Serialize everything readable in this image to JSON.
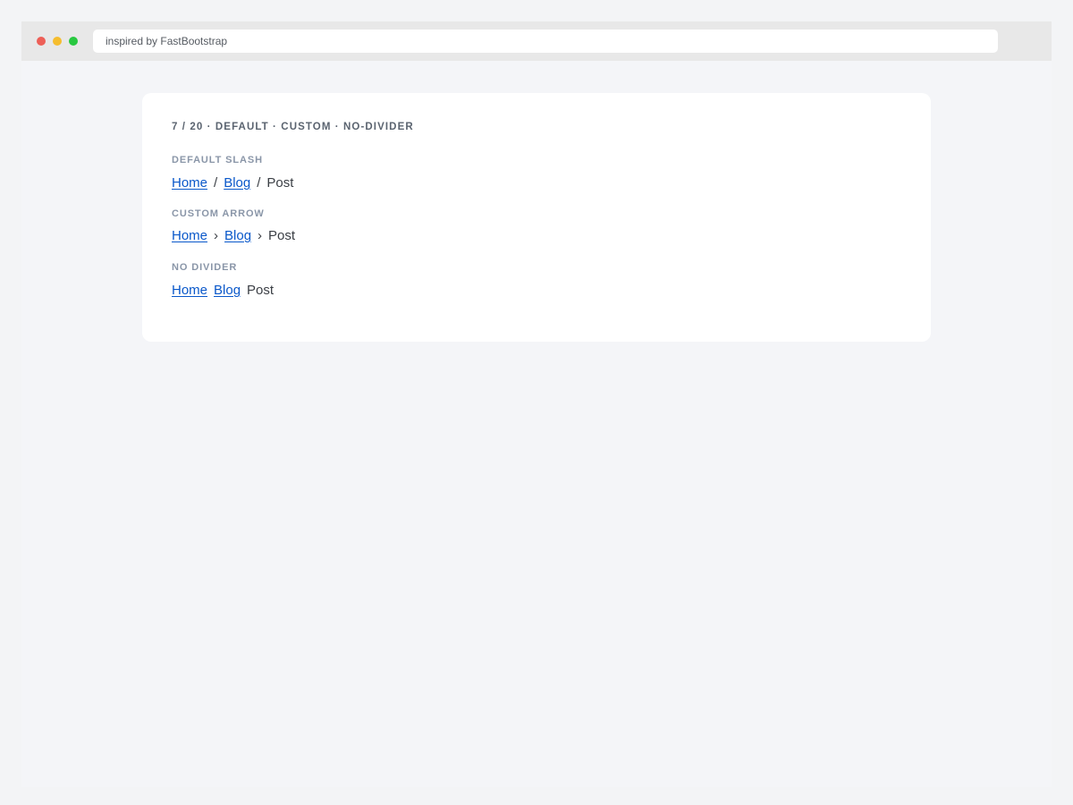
{
  "browser": {
    "url": "inspired by FastBootstrap",
    "dots": {
      "red": "#ed5f57",
      "yellow": "#f5bd2e",
      "green": "#28c840"
    }
  },
  "card": {
    "heading": "7 / 20 · DEFAULT · CUSTOM · NO-DIVIDER",
    "sections": [
      {
        "label": "DEFAULT SLASH",
        "separator": "/",
        "items": [
          "Home",
          "Blog"
        ],
        "current": "Post"
      },
      {
        "label": "CUSTOM ARROW",
        "separator": "›",
        "items": [
          "Home",
          "Blog"
        ],
        "current": "Post"
      },
      {
        "label": "NO DIVIDER",
        "separator": "",
        "items": [
          "Home",
          "Blog"
        ],
        "current": "Post"
      }
    ]
  },
  "colors": {
    "link": "#0a58ca",
    "text": "#3b3f45",
    "label": "#8a96a8",
    "heading": "#5b6470"
  }
}
